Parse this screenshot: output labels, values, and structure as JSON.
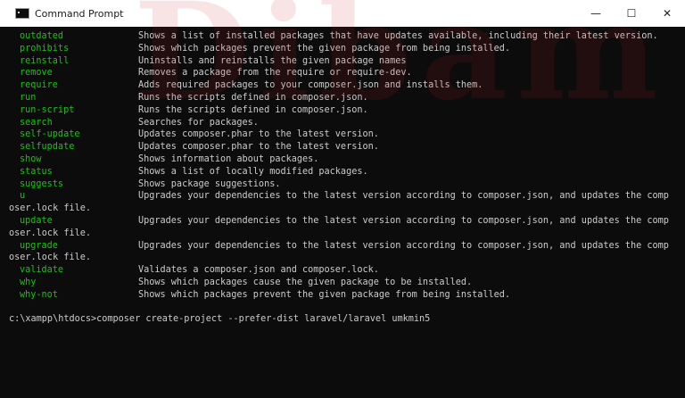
{
  "window": {
    "title": "Command Prompt",
    "minimize_glyph": "—",
    "maximize_glyph": "☐",
    "close_glyph": "✕",
    "icon": "terminal-icon"
  },
  "watermark": {
    "text": "Dibam"
  },
  "commands": [
    {
      "name": "outdated",
      "desc": "Shows a list of installed packages that have updates available, including their latest version."
    },
    {
      "name": "prohibits",
      "desc": "Shows which packages prevent the given package from being installed."
    },
    {
      "name": "reinstall",
      "desc": "Uninstalls and reinstalls the given package names"
    },
    {
      "name": "remove",
      "desc": "Removes a package from the require or require-dev."
    },
    {
      "name": "require",
      "desc": "Adds required packages to your composer.json and installs them."
    },
    {
      "name": "run",
      "desc": "Runs the scripts defined in composer.json."
    },
    {
      "name": "run-script",
      "desc": "Runs the scripts defined in composer.json."
    },
    {
      "name": "search",
      "desc": "Searches for packages."
    },
    {
      "name": "self-update",
      "desc": "Updates composer.phar to the latest version."
    },
    {
      "name": "selfupdate",
      "desc": "Updates composer.phar to the latest version."
    },
    {
      "name": "show",
      "desc": "Shows information about packages."
    },
    {
      "name": "status",
      "desc": "Shows a list of locally modified packages."
    },
    {
      "name": "suggests",
      "desc": "Shows package suggestions."
    },
    {
      "name": "u",
      "desc": "Upgrades your dependencies to the latest version according to composer.json, and updates the comp",
      "wrap": "oser.lock file."
    },
    {
      "name": "update",
      "desc": "Upgrades your dependencies to the latest version according to composer.json, and updates the comp",
      "wrap": "oser.lock file."
    },
    {
      "name": "upgrade",
      "desc": "Upgrades your dependencies to the latest version according to composer.json, and updates the comp",
      "wrap": "oser.lock file."
    },
    {
      "name": "validate",
      "desc": "Validates a composer.json and composer.lock."
    },
    {
      "name": "why",
      "desc": "Shows which packages cause the given package to be installed."
    },
    {
      "name": "why-not",
      "desc": "Shows which packages prevent the given package from being installed."
    }
  ],
  "prompt": {
    "text": "c:\\xampp\\htdocs>composer create-project --prefer-dist laravel/laravel umkmin5"
  },
  "colors": {
    "command": "#16c60c",
    "text": "#cccccc",
    "background": "#0c0c0c"
  }
}
